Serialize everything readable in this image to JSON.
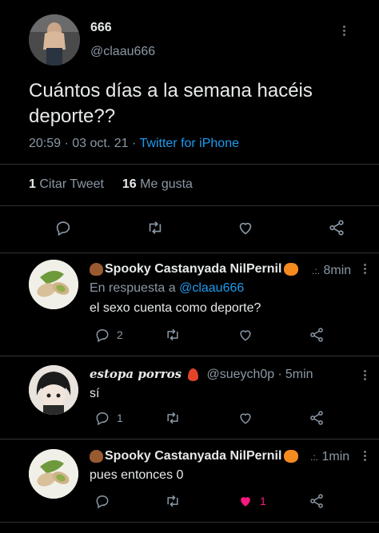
{
  "main_tweet": {
    "author_name": "666",
    "author_handle": "@claau666",
    "text": "Cuántos días a la semana hacéis deporte??",
    "time": "20:59",
    "date": "03 oct. 21",
    "source": "Twitter for iPhone",
    "quote_count": "1",
    "quote_label": "Citar Tweet",
    "like_count": "16",
    "like_label": "Me gusta"
  },
  "replies": [
    {
      "author_name": "Spooky Castanyada NilPernil",
      "time_ago": "8min",
      "reply_prefix": "En respuesta a",
      "reply_to": "@claau666",
      "text": "el sexo cuenta como deporte?",
      "reply_count": "2"
    },
    {
      "author_name": "estopa porros",
      "author_handle": "@sueych0p",
      "time_ago": "5min",
      "text": "sí",
      "reply_count": "1"
    },
    {
      "author_name": "Spooky Castanyada NilPernil",
      "time_ago": "1min",
      "text": "pues entonces 0",
      "like_count": "1"
    }
  ],
  "colors": {
    "background": "#000000",
    "text": "#e7e9ea",
    "muted": "#8b98a5",
    "link": "#1d9bf0",
    "like_active": "#f91880",
    "divider": "#2f3336"
  },
  "icons": [
    "reply-icon",
    "retweet-icon",
    "like-icon",
    "share-icon",
    "more-icon",
    "chestnut-emoji",
    "pumpkin-emoji",
    "fire-emoji"
  ]
}
